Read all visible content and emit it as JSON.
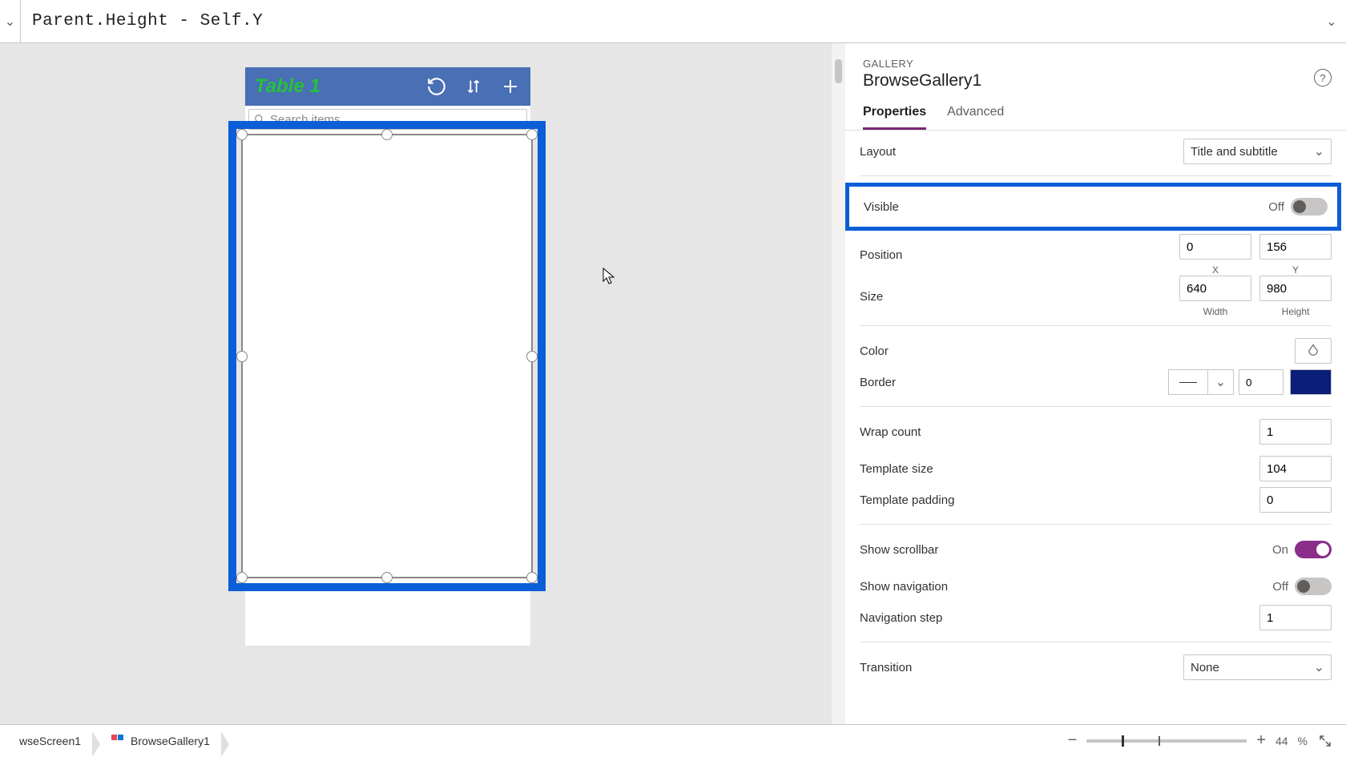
{
  "formula": "Parent.Height - Self.Y",
  "canvas": {
    "app_title": "Table 1",
    "search_placeholder": "Search items"
  },
  "selection": {
    "type_label": "GALLERY",
    "name": "BrowseGallery1"
  },
  "tabs": {
    "properties": "Properties",
    "advanced": "Advanced"
  },
  "props": {
    "layout": {
      "label": "Layout",
      "value": "Title and subtitle"
    },
    "visible": {
      "label": "Visible",
      "state_text": "Off"
    },
    "position": {
      "label": "Position",
      "x": "0",
      "y": "156",
      "xlabel": "X",
      "ylabel": "Y"
    },
    "size": {
      "label": "Size",
      "w": "640",
      "h": "980",
      "wlabel": "Width",
      "hlabel": "Height"
    },
    "color": {
      "label": "Color"
    },
    "border": {
      "label": "Border",
      "value": "0",
      "color": "#0a1e7a"
    },
    "wrap_count": {
      "label": "Wrap count",
      "value": "1"
    },
    "template_size": {
      "label": "Template size",
      "value": "104"
    },
    "template_padding": {
      "label": "Template padding",
      "value": "0"
    },
    "show_scrollbar": {
      "label": "Show scrollbar",
      "state_text": "On"
    },
    "show_navigation": {
      "label": "Show navigation",
      "state_text": "Off"
    },
    "navigation_step": {
      "label": "Navigation step",
      "value": "1"
    },
    "transition": {
      "label": "Transition",
      "value": "None"
    }
  },
  "status": {
    "crumb1": "wseScreen1",
    "crumb2": "BrowseGallery1",
    "zoom_percent": "44",
    "zoom_suffix": "%"
  }
}
